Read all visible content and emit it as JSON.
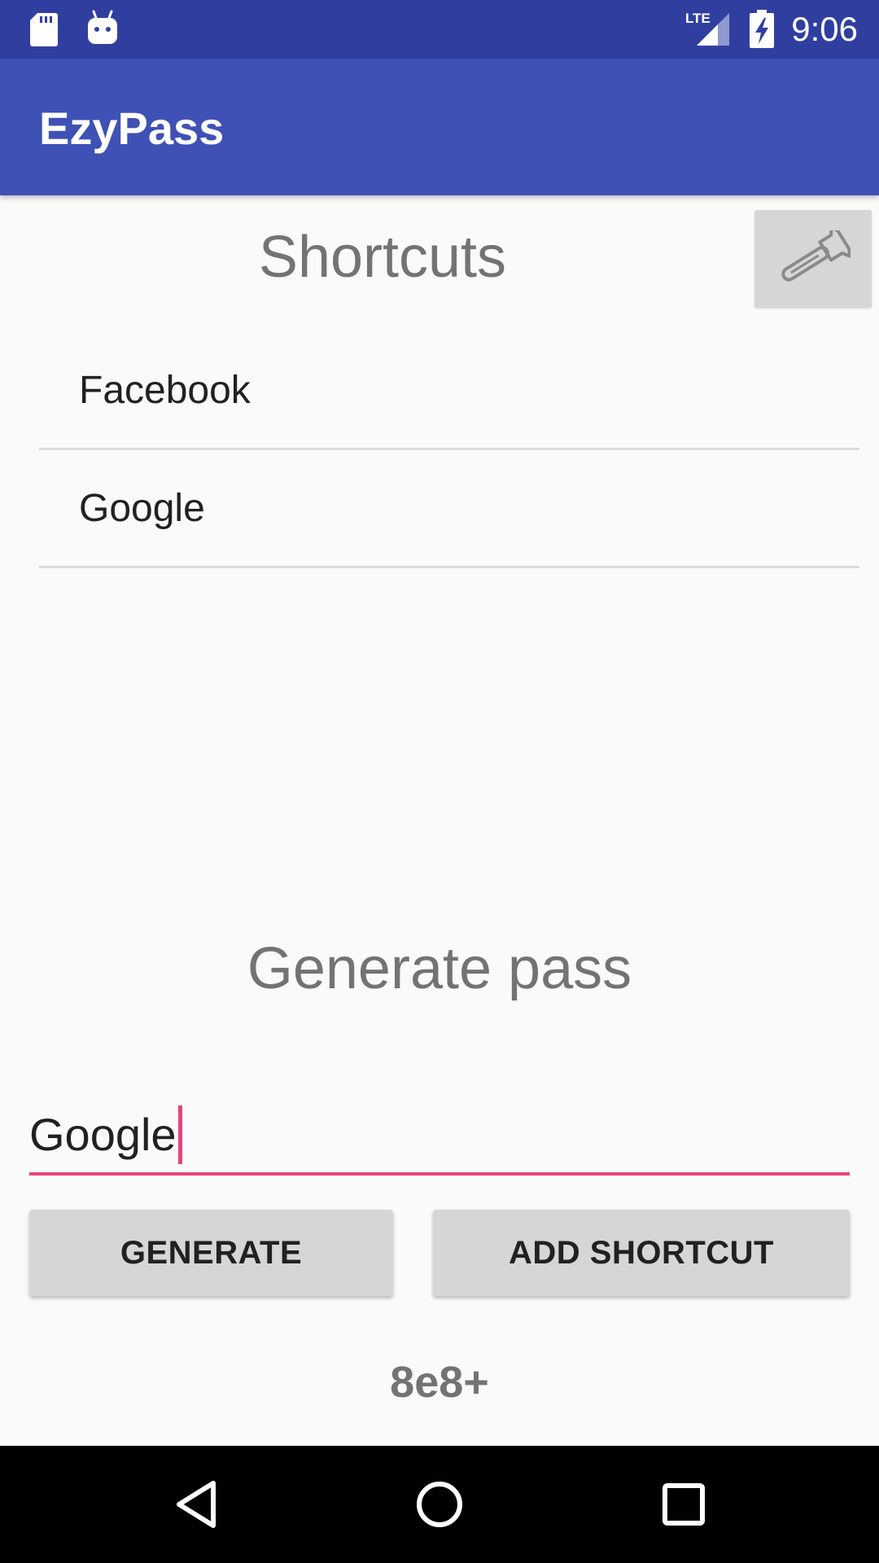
{
  "status_bar": {
    "time": "9:06",
    "icons": [
      "sd-card-icon",
      "android-icon",
      "lte-signal-icon",
      "battery-charging-icon"
    ]
  },
  "app_bar": {
    "title": "EzyPass"
  },
  "shortcuts": {
    "title": "Shortcuts",
    "settings_icon": "wrench-icon",
    "items": [
      {
        "label": "Facebook"
      },
      {
        "label": "Google"
      }
    ]
  },
  "generate": {
    "title": "Generate pass",
    "input_value": "Google",
    "generate_label": "GENERATE",
    "add_shortcut_label": "ADD SHORTCUT",
    "result": "8e8+"
  },
  "colors": {
    "status_bar": "#303f9f",
    "app_bar": "#3f51b5",
    "accent": "#e8437c",
    "button": "#d6d6d6"
  },
  "nav_bar": {
    "icons": [
      "back-icon",
      "home-icon",
      "recents-icon"
    ]
  }
}
